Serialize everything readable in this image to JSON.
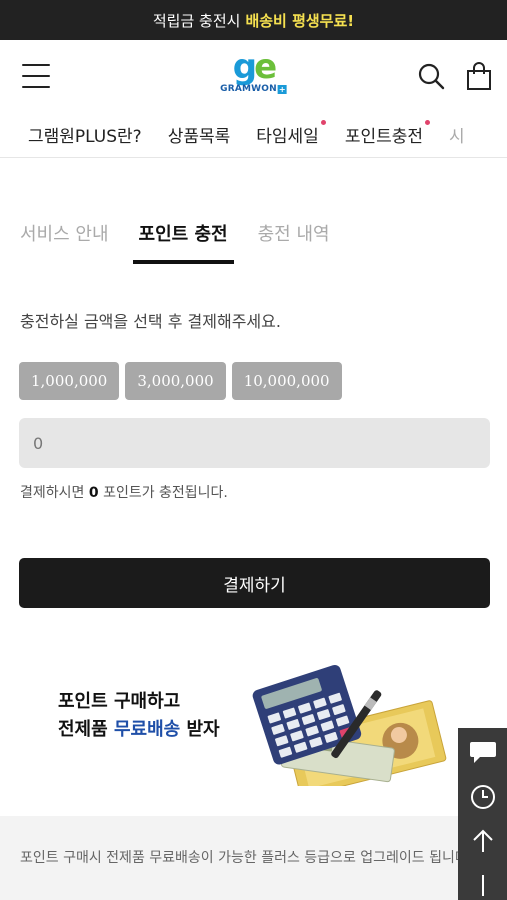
{
  "topbar": {
    "text": "적립금 충전시",
    "highlight": "배송비 평생무료!"
  },
  "header": {
    "logo_text": "GRAMWON",
    "logo_plus": "+",
    "menu_icon": "hamburger-icon",
    "search_icon": "search-icon",
    "cart_icon": "shopping-bag-icon"
  },
  "nav": {
    "items": [
      {
        "label": "그램원PLUS란?",
        "dot": false
      },
      {
        "label": "상품목록",
        "dot": false
      },
      {
        "label": "타임세일",
        "dot": true
      },
      {
        "label": "포인트충전",
        "dot": true
      },
      {
        "label": "시",
        "dot": false
      }
    ]
  },
  "tabs": [
    {
      "label": "서비스 안내",
      "active": false
    },
    {
      "label": "포인트 충전",
      "active": true
    },
    {
      "label": "충전 내역",
      "active": false
    }
  ],
  "guide_text": "충전하실 금액을 선택 후 결제해주세요.",
  "amount_options": [
    "1,000,000",
    "3,000,000",
    "10,000,000"
  ],
  "amount_input": {
    "value": "0"
  },
  "result": {
    "prefix": "결제하시면",
    "points": "0",
    "suffix": "포인트가 충전됩니다."
  },
  "pay_button": "결제하기",
  "banner": {
    "line1": "포인트 구매하고",
    "line2_a": "전제품",
    "line2_b": "무료배송",
    "line2_c": "받자"
  },
  "notice": "포인트 구매시 전제품 무료배송이 가능한 플러스 등급으로 업그레이드 됩니다.",
  "sidebar": [
    "chat-icon",
    "clock-icon",
    "arrow-up-icon",
    "arrow-down-icon"
  ],
  "colors": {
    "accent_yellow": "#f5e050",
    "brand_blue": "#1a9ad8",
    "brand_green": "#6bbf3a",
    "dot_pink": "#e0436b",
    "banner_blue": "#1f4fa8"
  }
}
